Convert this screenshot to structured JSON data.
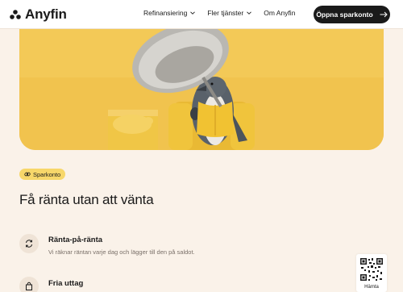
{
  "header": {
    "brand": "Anyfin",
    "nav": [
      {
        "label": "Refinansiering",
        "has_dropdown": true
      },
      {
        "label": "Fler tjänster",
        "has_dropdown": true
      },
      {
        "label": "Om Anyfin",
        "has_dropdown": false
      }
    ],
    "cta_label": "Öppna sparkonto",
    "cta_icon": "arrow-right-icon"
  },
  "hero": {
    "image": "penguin-in-yellow-armchair-under-hair-dryer",
    "colors": {
      "background": "#f1c34e"
    }
  },
  "badge": {
    "label": "Sparkonto",
    "icon": "link-icon"
  },
  "headline": "Få ränta utan att vänta",
  "features": [
    {
      "icon": "refresh-icon",
      "title": "Ränta-på-ränta",
      "description": "Vi räknar räntan varje dag och lägger till den på saldot."
    },
    {
      "icon": "bag-icon",
      "title": "Fria uttag",
      "description": ""
    }
  ],
  "qr": {
    "label": "Hämta"
  },
  "colors": {
    "page_bg": "#faf2e9",
    "badge_bg": "#f7d76a",
    "cta_bg": "#1a1a1a"
  }
}
